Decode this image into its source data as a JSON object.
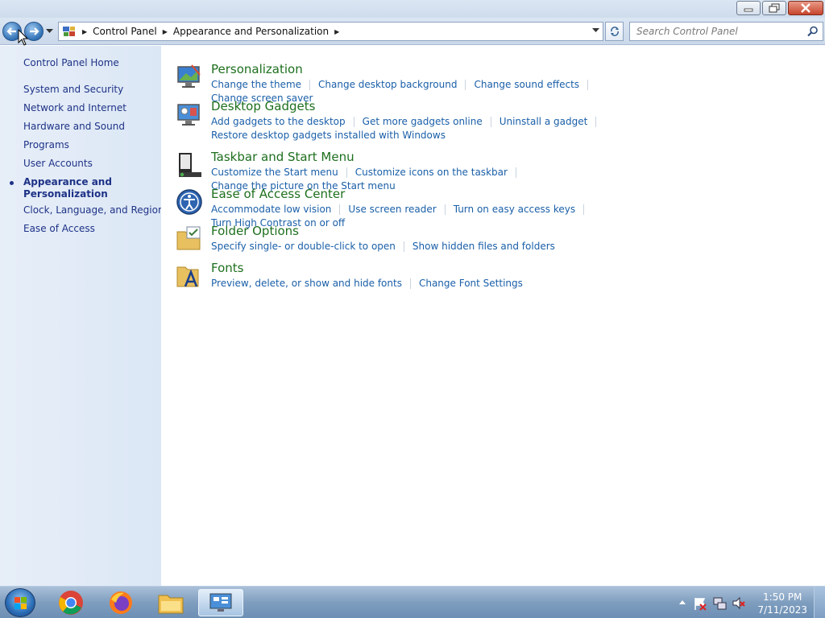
{
  "window": {
    "controls": {
      "minimize": "minimize",
      "restore": "restore",
      "close": "close"
    }
  },
  "nav": {
    "breadcrumbs": [
      "Control Panel",
      "Appearance and Personalization"
    ],
    "search_placeholder": "Search Control Panel"
  },
  "sidebar": {
    "home": "Control Panel Home",
    "items": [
      "System and Security",
      "Network and Internet",
      "Hardware and Sound",
      "Programs",
      "User Accounts"
    ],
    "current_line1": "Appearance and",
    "current_line2": "Personalization",
    "items_after": [
      "Clock, Language, and Region",
      "Ease of Access"
    ]
  },
  "categories": [
    {
      "title": "Personalization",
      "icon": "personalization-icon",
      "links": [
        "Change the theme",
        "Change desktop background",
        "Change sound effects",
        "Change screen saver"
      ]
    },
    {
      "title": "Desktop Gadgets",
      "icon": "desktop-gadgets-icon",
      "links": [
        "Add gadgets to the desktop",
        "Get more gadgets online",
        "Uninstall a gadget"
      ],
      "links_row2": [
        "Restore desktop gadgets installed with Windows"
      ]
    },
    {
      "title": "Taskbar and Start Menu",
      "icon": "taskbar-icon",
      "links": [
        "Customize the Start menu",
        "Customize icons on the taskbar",
        "Change the picture on the Start menu"
      ]
    },
    {
      "title": "Ease of Access Center",
      "icon": "ease-of-access-icon",
      "links": [
        "Accommodate low vision",
        "Use screen reader",
        "Turn on easy access keys",
        "Turn High Contrast on or off"
      ]
    },
    {
      "title": "Folder Options",
      "icon": "folder-options-icon",
      "links": [
        "Specify single- or double-click to open",
        "Show hidden files and folders"
      ]
    },
    {
      "title": "Fonts",
      "icon": "fonts-icon",
      "links": [
        "Preview, delete, or show and hide fonts",
        "Change Font Settings"
      ]
    }
  ],
  "taskbar": {
    "apps": [
      "chrome-icon",
      "firefox-icon",
      "explorer-icon",
      "control-panel-icon"
    ],
    "time": "1:50 PM",
    "date": "7/11/2023"
  }
}
